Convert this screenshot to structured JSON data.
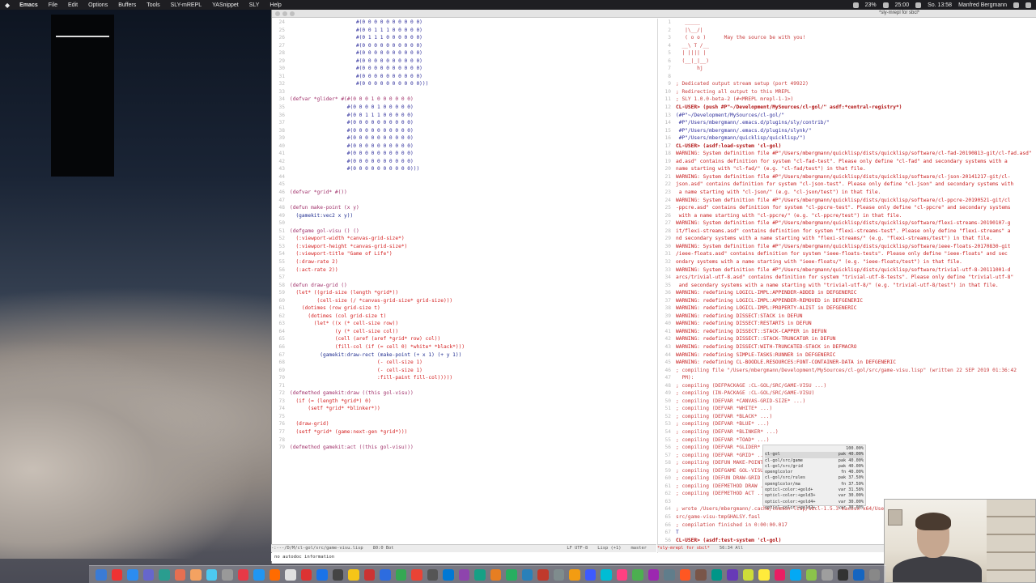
{
  "menubar": {
    "apple_icon": "",
    "items": [
      "Emacs",
      "File",
      "Edit",
      "Options",
      "Buffers",
      "Tools",
      "SLY-mREPL",
      "YASnippet",
      "SLY",
      "Help"
    ],
    "battery": "23%",
    "time_display": "25:00",
    "clock": "So. 13:58",
    "user": "Manfred Bergmann"
  },
  "window": {
    "title": "*sly-mrepl for sbcl*"
  },
  "left_pane": {
    "lines": [
      {
        "n": "24",
        "t": "                      #(0 0 0 0 0 0 0 0 0 0)",
        "c": "blue"
      },
      {
        "n": "25",
        "t": "                      #(0 0 1 1 1 0 0 0 0 0)",
        "c": "blue"
      },
      {
        "n": "26",
        "t": "                      #(0 1 1 1 0 0 0 0 0 0)",
        "c": "blue"
      },
      {
        "n": "27",
        "t": "                      #(0 0 0 0 0 0 0 0 0 0)",
        "c": "blue"
      },
      {
        "n": "28",
        "t": "                      #(0 0 0 0 0 0 0 0 0 0)",
        "c": "blue"
      },
      {
        "n": "29",
        "t": "                      #(0 0 0 0 0 0 0 0 0 0)",
        "c": "blue"
      },
      {
        "n": "30",
        "t": "                      #(0 0 0 0 0 0 0 0 0 0)",
        "c": "blue"
      },
      {
        "n": "31",
        "t": "                      #(0 0 0 0 0 0 0 0 0 0)",
        "c": "blue"
      },
      {
        "n": "32",
        "t": "                      #(0 0 0 0 0 0 0 0 0 0)))",
        "c": "blue"
      },
      {
        "n": "33",
        "t": "",
        "c": ""
      },
      {
        "n": "34",
        "t": "(defvar *glider* #(#(0 0 0 1 0 0 0 0 0 0)",
        "c": "kw"
      },
      {
        "n": "35",
        "t": "                   #(0 0 0 0 1 0 0 0 0 0)",
        "c": "blue"
      },
      {
        "n": "36",
        "t": "                   #(0 0 1 1 1 0 0 0 0 0)",
        "c": "blue"
      },
      {
        "n": "37",
        "t": "                   #(0 0 0 0 0 0 0 0 0 0)",
        "c": "blue"
      },
      {
        "n": "38",
        "t": "                   #(0 0 0 0 0 0 0 0 0 0)",
        "c": "blue"
      },
      {
        "n": "39",
        "t": "                   #(0 0 0 0 0 0 0 0 0 0)",
        "c": "blue"
      },
      {
        "n": "40",
        "t": "                   #(0 0 0 0 0 0 0 0 0 0)",
        "c": "blue"
      },
      {
        "n": "41",
        "t": "                   #(0 0 0 0 0 0 0 0 0 0)",
        "c": "blue"
      },
      {
        "n": "42",
        "t": "                   #(0 0 0 0 0 0 0 0 0 0)",
        "c": "blue"
      },
      {
        "n": "43",
        "t": "                   #(0 0 0 0 0 0 0 0 0 0)))",
        "c": "blue"
      },
      {
        "n": "44",
        "t": "",
        "c": ""
      },
      {
        "n": "45",
        "t": "",
        "c": ""
      },
      {
        "n": "46",
        "t": "(defvar *grid* #())",
        "c": "kw"
      },
      {
        "n": "47",
        "t": "",
        "c": ""
      },
      {
        "n": "48",
        "t": "(defun make-point (x y)",
        "c": "kw"
      },
      {
        "n": "49",
        "t": "  (gamekit:vec2 x y))",
        "c": "fn"
      },
      {
        "n": "50",
        "t": "",
        "c": ""
      },
      {
        "n": "51",
        "t": "(defgame gol-visu () ()",
        "c": "kw"
      },
      {
        "n": "52",
        "t": "  (:viewport-width *canvas-grid-size*)",
        "c": "red"
      },
      {
        "n": "53",
        "t": "  (:viewport-height *canvas-grid-size*)",
        "c": "red"
      },
      {
        "n": "54",
        "t": "  (:viewport-title \"Game of Life\")",
        "c": "red"
      },
      {
        "n": "55",
        "t": "  (:draw-rate 2)",
        "c": "red"
      },
      {
        "n": "56",
        "t": "  (:act-rate 2))",
        "c": "red"
      },
      {
        "n": "57",
        "t": "",
        "c": ""
      },
      {
        "n": "58",
        "t": "(defun draw-grid ()",
        "c": "kw"
      },
      {
        "n": "59",
        "t": "  (let* ((grid-size (length *grid*))",
        "c": "red"
      },
      {
        "n": "60",
        "t": "         (cell-size (/ *canvas-grid-size* grid-size)))",
        "c": "red"
      },
      {
        "n": "61",
        "t": "    (dotimes (row grid-size t)",
        "c": "red"
      },
      {
        "n": "62",
        "t": "      (dotimes (col grid-size t)",
        "c": "red"
      },
      {
        "n": "63",
        "t": "        (let* ((x (* cell-size row))",
        "c": "red"
      },
      {
        "n": "64",
        "t": "               (y (* cell-size col))",
        "c": "red"
      },
      {
        "n": "65",
        "t": "               (cell (aref (aref *grid* row) col))",
        "c": "red"
      },
      {
        "n": "66",
        "t": "               (fill-col (if (= cell 0) *white* *black*)))",
        "c": "red"
      },
      {
        "n": "67",
        "t": "          (gamekit:draw-rect (make-point (+ x 1) (+ y 1))",
        "c": "fn"
      },
      {
        "n": "68",
        "t": "                             (- cell-size 1)",
        "c": "red"
      },
      {
        "n": "69",
        "t": "                             (- cell-size 1)",
        "c": "red"
      },
      {
        "n": "70",
        "t": "                             :fill-paint fill-col)))))",
        "c": "red"
      },
      {
        "n": "71",
        "t": "",
        "c": ""
      },
      {
        "n": "72",
        "t": "(defmethod gamekit:draw ((this gol-visu))",
        "c": "kw"
      },
      {
        "n": "73",
        "t": "  (if (= (length *grid*) 0)",
        "c": "red"
      },
      {
        "n": "74",
        "t": "      (setf *grid* *blinker*))",
        "c": "red"
      },
      {
        "n": "75",
        "t": "",
        "c": ""
      },
      {
        "n": "76",
        "t": "  (draw-grid)",
        "c": "red"
      },
      {
        "n": "77",
        "t": "  (setf *grid* (game:next-gen *grid*)))",
        "c": "red"
      },
      {
        "n": "78",
        "t": "",
        "c": ""
      },
      {
        "n": "79",
        "t": "(defmethod gamekit:act ((this gol-visu)))",
        "c": "kw"
      }
    ]
  },
  "right_pane": {
    "lines": [
      {
        "n": "1",
        "t": "   _____",
        "c": "comment"
      },
      {
        "n": "2",
        "t": "   |\\__/|",
        "c": "comment"
      },
      {
        "n": "3",
        "t": "   ( o o )      May the source be with you!",
        "c": "comment"
      },
      {
        "n": "4",
        "t": "  __\\ T /__",
        "c": "comment"
      },
      {
        "n": "5",
        "t": "  | |||| |",
        "c": "comment"
      },
      {
        "n": "6",
        "t": "  (__|_|__)",
        "c": "comment"
      },
      {
        "n": "7",
        "t": "       hj",
        "c": "comment"
      },
      {
        "n": "8",
        "t": "",
        "c": ""
      },
      {
        "n": "9",
        "t": "; Dedicated output stream setup (port 49922)",
        "c": "comment"
      },
      {
        "n": "10",
        "t": "; Redirecting all output to this MREPL",
        "c": "comment"
      },
      {
        "n": "11",
        "t": "; SLY 1.0.0-beta-2 (#<MREPL mrepl-1-1>)",
        "c": "comment"
      },
      {
        "n": "12",
        "t": "CL-USER> (push #P\"~/Development/MySources/cl-gol/\" asdf:*central-registry*)",
        "c": "prompt"
      },
      {
        "n": "13",
        "t": "(#P\"~/Development/MySources/cl-gol/\"",
        "c": "blue"
      },
      {
        "n": "14",
        "t": " #P\"/Users/mbergmann/.emacs.d/plugins/sly/contrib/\"",
        "c": "blue"
      },
      {
        "n": "15",
        "t": " #P\"/Users/mbergmann/.emacs.d/plugins/slynk/\"",
        "c": "blue"
      },
      {
        "n": "16",
        "t": " #P\"/Users/mbergmann/quicklisp/quicklisp/\")",
        "c": "blue"
      },
      {
        "n": "17",
        "t": "CL-USER> (asdf:load-system 'cl-gol)",
        "c": "prompt"
      },
      {
        "n": "18",
        "t": "WARNING: System definition file #P\"/Users/mbergmann/quicklisp/dists/quicklisp/software/cl-fad-20190813-git/cl-fad.asd\"",
        "c": "warn"
      },
      {
        "n": "19",
        "t": "ad.asd\" contains definition for system \"cl-fad-test\". Please only define \"cl-fad\" and secondary systems with a",
        "c": "warn"
      },
      {
        "n": "20",
        "t": "name starting with \"cl-fad/\" (e.g. \"cl-fad/test\") in that file.",
        "c": "warn"
      },
      {
        "n": "21",
        "t": "WARNING: System definition file #P\"/Users/mbergmann/quicklisp/dists/quicklisp/software/cl-json-20141217-git/cl-",
        "c": "warn"
      },
      {
        "n": "22",
        "t": "json.asd\" contains definition for system \"cl-json-test\". Please only define \"cl-json\" and secondary systems with",
        "c": "warn"
      },
      {
        "n": "23",
        "t": " a name starting with \"cl-json/\" (e.g. \"cl-json/test\") in that file.",
        "c": "warn"
      },
      {
        "n": "24",
        "t": "WARNING: System definition file #P\"/Users/mbergmann/quicklisp/dists/quicklisp/software/cl-ppcre-20190521-git/cl",
        "c": "warn"
      },
      {
        "n": "25",
        "t": "-ppcre.asd\" contains definition for system \"cl-ppcre-test\". Please only define \"cl-ppcre\" and secondary systems",
        "c": "warn"
      },
      {
        "n": "26",
        "t": " with a name starting with \"cl-ppcre/\" (e.g. \"cl-ppcre/test\") in that file.",
        "c": "warn"
      },
      {
        "n": "27",
        "t": "WARNING: System definition file #P\"/Users/mbergmann/quicklisp/dists/quicklisp/software/flexi-streams-20190107-g",
        "c": "warn"
      },
      {
        "n": "28",
        "t": "it/flexi-streams.asd\" contains definition for system \"flexi-streams-test\". Please only define \"flexi-streams\" a",
        "c": "warn"
      },
      {
        "n": "29",
        "t": "nd secondary systems with a name starting with \"flexi-streams/\" (e.g. \"flexi-streams/test\") in that file.",
        "c": "warn"
      },
      {
        "n": "30",
        "t": "WARNING: System definition file #P\"/Users/mbergmann/quicklisp/dists/quicklisp/software/ieee-floats-20170830-git",
        "c": "warn"
      },
      {
        "n": "31",
        "t": "/ieee-floats.asd\" contains definition for system \"ieee-floats-tests\". Please only define \"ieee-floats\" and sec",
        "c": "warn"
      },
      {
        "n": "32",
        "t": "ondary systems with a name starting with \"ieee-floats/\" (e.g. \"ieee-floats/test\") in that file.",
        "c": "warn"
      },
      {
        "n": "33",
        "t": "WARNING: System definition file #P\"/Users/mbergmann/quicklisp/dists/quicklisp/software/trivial-utf-8-20111001-d",
        "c": "warn"
      },
      {
        "n": "34",
        "t": "arcs/trivial-utf-8.asd\" contains definition for system \"trivial-utf-8-tests\". Please only define \"trivial-utf-8\"",
        "c": "warn"
      },
      {
        "n": "35",
        "t": " and secondary systems with a name starting with \"trivial-utf-8/\" (e.g. \"trivial-utf-8/test\") in that file.",
        "c": "warn"
      },
      {
        "n": "36",
        "t": "WARNING: redefining LOGICL-IMPL:APPENDER-ADDED in DEFGENERIC",
        "c": "warn"
      },
      {
        "n": "37",
        "t": "WARNING: redefining LOGICL-IMPL:APPENDER-REMOVED in DEFGENERIC",
        "c": "warn"
      },
      {
        "n": "38",
        "t": "WARNING: redefining LOGICL-IMPL:PROPERTY-ALIST in DEFGENERIC",
        "c": "warn"
      },
      {
        "n": "39",
        "t": "WARNING: redefining DISSECT:STACK in DEFUN",
        "c": "warn"
      },
      {
        "n": "40",
        "t": "WARNING: redefining DISSECT:RESTARTS in DEFUN",
        "c": "warn"
      },
      {
        "n": "41",
        "t": "WARNING: redefining DISSECT::STACK-CAPPER in DEFUN",
        "c": "warn"
      },
      {
        "n": "42",
        "t": "WARNING: redefining DISSECT::STACK-TRUNCATOR in DEFUN",
        "c": "warn"
      },
      {
        "n": "43",
        "t": "WARNING: redefining DISSECT:WITH-TRUNCATED-STACK in DEFMACRO",
        "c": "warn"
      },
      {
        "n": "44",
        "t": "WARNING: redefining SIMPLE-TASKS:RUNNER in DEFGENERIC",
        "c": "warn"
      },
      {
        "n": "45",
        "t": "WARNING: redefining CL-BOODLE.RESOURCES:FONT-CONTAINER-DATA in DEFGENERIC",
        "c": "warn"
      },
      {
        "n": "46",
        "t": "; compiling file \"/Users/mbergmann/Development/MySources/cl-gol/src/game-visu.lisp\" (written 22 SEP 2019 01:36:42",
        "c": "comment"
      },
      {
        "n": "47",
        "t": "  PM):",
        "c": "comment"
      },
      {
        "n": "48",
        "t": "; compiling (DEFPACKAGE :CL-GOL/SRC/GAME-VISU ...)",
        "c": "comment"
      },
      {
        "n": "49",
        "t": "; compiling (IN-PACKAGE :CL-GOL/SRC/GAME-VISU)",
        "c": "comment"
      },
      {
        "n": "50",
        "t": "; compiling (DEFVAR *CANVAS-GRID-SIZE* ...)",
        "c": "comment"
      },
      {
        "n": "51",
        "t": "; compiling (DEFVAR *WHITE* ...)",
        "c": "comment"
      },
      {
        "n": "52",
        "t": "; compiling (DEFVAR *BLACK* ...)",
        "c": "comment"
      },
      {
        "n": "53",
        "t": "; compiling (DEFVAR *BLUE* ...)",
        "c": "comment"
      },
      {
        "n": "54",
        "t": "; compiling (DEFVAR *BLINKER* ...)",
        "c": "comment"
      },
      {
        "n": "55",
        "t": "; compiling (DEFVAR *TOAD* ...)",
        "c": "comment"
      },
      {
        "n": "56",
        "t": "; compiling (DEFVAR *GLIDER* ...)",
        "c": "comment"
      },
      {
        "n": "57",
        "t": "; compiling (DEFVAR *GRID* ...)",
        "c": "comment"
      },
      {
        "n": "58",
        "t": "; compiling (DEFUN MAKE-POINT ...)",
        "c": "comment"
      },
      {
        "n": "59",
        "t": "; compiling (DEFGAME GOL-VISU ...)",
        "c": "comment"
      },
      {
        "n": "60",
        "t": "; compiling (DEFUN DRAW-GRID ...)",
        "c": "comment"
      },
      {
        "n": "61",
        "t": "; compiling (DEFMETHOD DRAW ...)",
        "c": "comment"
      },
      {
        "n": "62",
        "t": "; compiling (DEFMETHOD ACT ...)",
        "c": "comment"
      },
      {
        "n": "63",
        "t": "",
        "c": ""
      },
      {
        "n": "64",
        "t": "; wrote /Users/mbergmann/.cache/common-lisp/sbcl-1.5.3-macosx-x64/Users/mbergmann/Development/MySources/cl-gol/",
        "c": "comment"
      },
      {
        "n": "65",
        "t": "src/game-visu-tmpGHALSY.fasl",
        "c": "comment"
      },
      {
        "n": "66",
        "t": "; compilation finished in 0:00:00.017",
        "c": "comment"
      },
      {
        "n": "67",
        "t": "T",
        "c": "blue"
      },
      {
        "n": "56",
        "t": "CL-USER> (asdf:test-system 'cl-gol)",
        "c": "prompt"
      }
    ]
  },
  "completion": {
    "items": [
      {
        "name": "",
        "kind": "100.00%"
      },
      {
        "name": "cl-gol",
        "kind": "pak 40.00%"
      },
      {
        "name": "cl-gol/src/game",
        "kind": "pak 40.00%"
      },
      {
        "name": "cl-gol/src/grid",
        "kind": "pak 40.00%"
      },
      {
        "name": "openglcolor",
        "kind": "fn 40.00%"
      },
      {
        "name": "cl-gol/src/rules",
        "kind": "pak 37.50%"
      },
      {
        "name": "openglcolor/ma",
        "kind": "fn 37.50%"
      },
      {
        "name": "opticl-color:+gold+",
        "kind": "var 31.58%"
      },
      {
        "name": "opticl-color:+gold3+",
        "kind": "var 30.00%"
      },
      {
        "name": "opticl-color:+gold4+",
        "kind": "var 30.00%"
      },
      {
        "name": "opticl-color:+gold2+",
        "kind": "var 30.00%"
      }
    ]
  },
  "modeline_left": {
    "path": "-:---/D/M/cl-gol/src/game-visu.lisp",
    "pos": "80:0  Bot",
    "encoding": "LF UTF-8",
    "mode": "Lisp (+1)",
    "branch": "master"
  },
  "modeline_right": {
    "buffer": "*sly-mrepl for sbcl*",
    "pos": "56:34  All"
  },
  "echo_area": {
    "message": "no autodoc information"
  },
  "dock": {
    "icon_colors": [
      "#3a7bd5",
      "#e33",
      "#2b8cf0",
      "#66c",
      "#2a9d8f",
      "#e76f51",
      "#f4a261",
      "#4cc9f0",
      "#999",
      "#e63946",
      "#2196f3",
      "#ff6b00",
      "#e0e0e0",
      "#d33",
      "#1a73e8",
      "#444",
      "#f5c518",
      "#c33",
      "#2d6cdf",
      "#34a853",
      "#ea4335",
      "#555",
      "#0078d4",
      "#8e44ad",
      "#16a085",
      "#e67e22",
      "#27ae60",
      "#2980b9",
      "#c0392b",
      "#7f8c8d",
      "#f39c12",
      "#3d5afe",
      "#00bcd4",
      "#ff4081",
      "#4caf50",
      "#9c27b0",
      "#607d8b",
      "#ff5722",
      "#795548",
      "#009688",
      "#673ab7",
      "#cddc39",
      "#ffeb3b",
      "#e91e63",
      "#03a9f4",
      "#8bc34a",
      "#9e9e9e",
      "#333",
      "#1565c0",
      "#888"
    ]
  }
}
